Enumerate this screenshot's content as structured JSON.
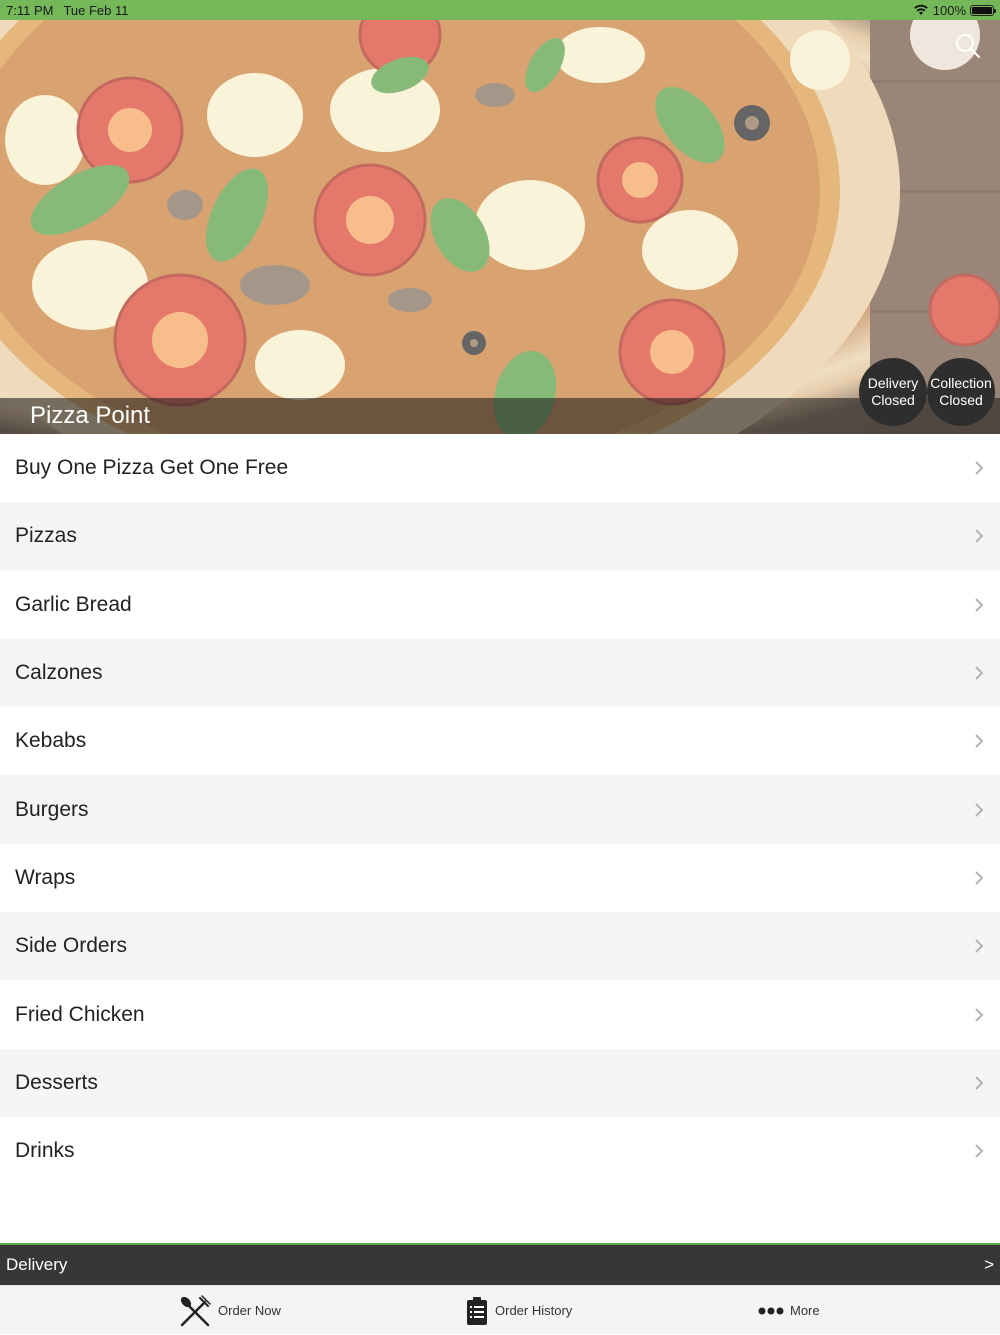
{
  "status_bar": {
    "time": "7:11 PM",
    "date": "Tue Feb 11",
    "battery": "100%",
    "wifi_icon": "wifi-icon",
    "battery_icon": "battery-icon"
  },
  "hero": {
    "restaurant_name": "Pizza Point",
    "search_icon": "search-icon",
    "delivery_status": {
      "line1": "Delivery",
      "line2": "Closed"
    },
    "collection_status": {
      "line1": "Collection",
      "line2": "Closed"
    }
  },
  "menu": {
    "items": [
      {
        "label": "Buy One Pizza Get One Free"
      },
      {
        "label": "Pizzas"
      },
      {
        "label": "Garlic Bread"
      },
      {
        "label": "Calzones"
      },
      {
        "label": "Kebabs"
      },
      {
        "label": "Burgers"
      },
      {
        "label": "Wraps"
      },
      {
        "label": "Side Orders"
      },
      {
        "label": "Fried Chicken"
      },
      {
        "label": "Desserts"
      },
      {
        "label": "Drinks"
      }
    ],
    "chevron_icon": "chevron-right-icon"
  },
  "order_mode_bar": {
    "label": "Delivery",
    "arrow": ">"
  },
  "tab_bar": {
    "tabs": [
      {
        "label": "Order Now",
        "icon": "fork-knife-icon"
      },
      {
        "label": "Order History",
        "icon": "clipboard-list-icon"
      },
      {
        "label": "More",
        "icon": "more-dots-icon"
      }
    ]
  },
  "colors": {
    "status_bar": "#74b85a",
    "bottom_bar": "#373737",
    "accent_line": "#5aa84a",
    "row_alt": "#f4f5f7"
  }
}
